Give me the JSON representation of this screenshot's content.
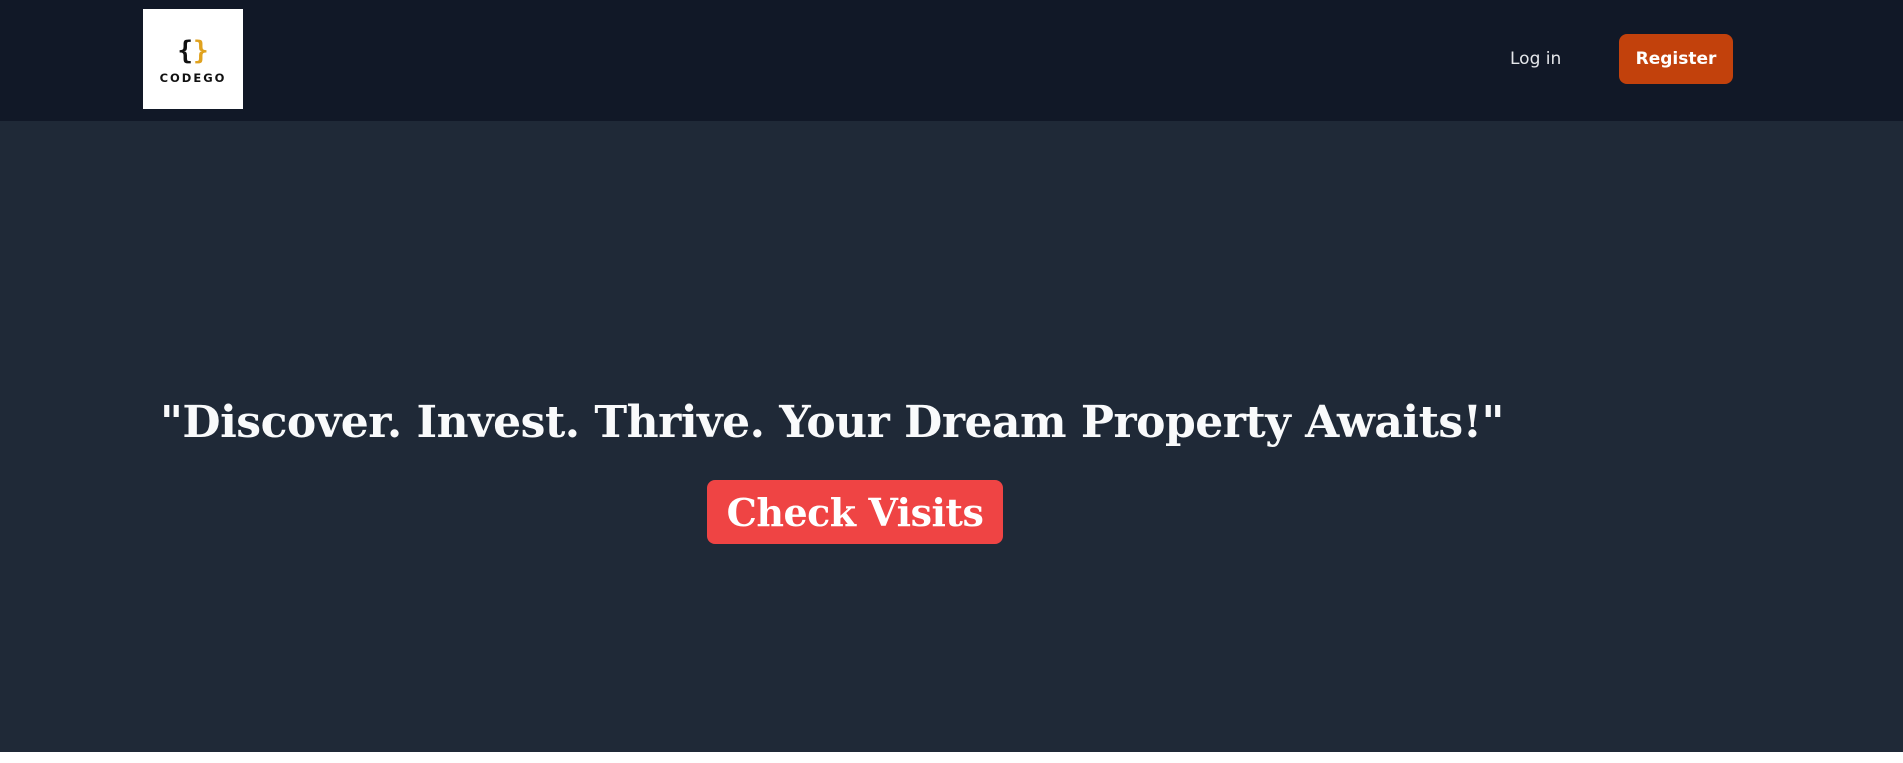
{
  "header": {
    "logo": {
      "mark_left": "{",
      "mark_right": "}",
      "wordmark": "CODEGO"
    },
    "login_label": "Log in",
    "register_label": "Register"
  },
  "hero": {
    "title": "\"Discover. Invest. Thrive. Your Dream Property Awaits!\"",
    "cta_label": "Check Visits"
  },
  "colors": {
    "navbar_bg": "#111827",
    "hero_bg": "#1f2937",
    "register_bg": "#c2410c",
    "cta_bg": "#ef4444",
    "logo_accent": "#e0a21f"
  }
}
